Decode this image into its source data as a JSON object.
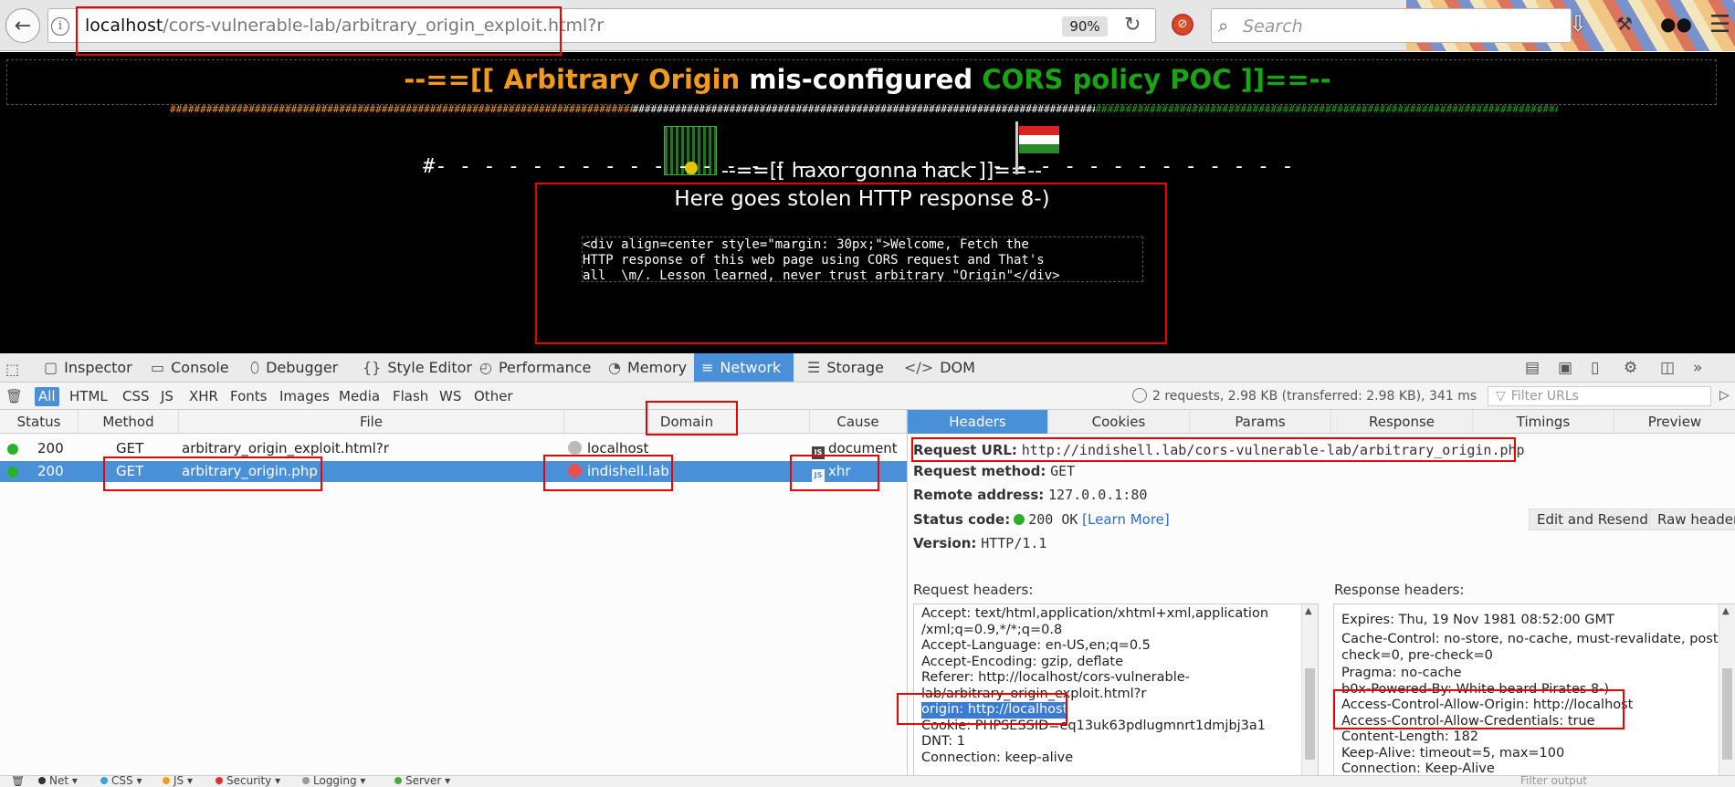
{
  "browser": {
    "url_host": "localhost",
    "url_path": "/cors-vulnerable-lab/arbitrary_origin_exploit.html?r",
    "zoom": "90%",
    "search_placeholder": "Search"
  },
  "page": {
    "title_part1": "--==[[ Arbitrary Origin ",
    "title_part2": "mis-configured ",
    "title_part3": "CORS policy POC ]]==--",
    "hash_segment_1": "##########################################################################################################",
    "hash_segment_2": "##########################################################################################################",
    "hash_segment_3": "##########################################################################################################",
    "subtitle": "--==[[ haxor gonna hack ]]==--",
    "dash_divider": "#- - - - - - - - - - - - - - - - - - - - - - - - - - - - - - - - - - - - - - - - - - - - - - - - - - - - - - - - - - - - - - - #",
    "stolen_title": "Here goes stolen HTTP response 8-)",
    "stolen_code": "<div align=center style=\"margin: 30px;\">Welcome, Fetch the\nHTTP response of this web page using CORS request and That's\nall  \\m/. Lesson learned, never trust arbitrary \"Origin\"</div>"
  },
  "devtools": {
    "tabs": [
      "Inspector",
      "Console",
      "Debugger",
      "Style Editor",
      "Performance",
      "Memory",
      "Network",
      "Storage",
      "DOM"
    ],
    "active_tab": "Network",
    "filter_types": [
      "All",
      "HTML",
      "CSS",
      "JS",
      "XHR",
      "Fonts",
      "Images",
      "Media",
      "Flash",
      "WS",
      "Other"
    ],
    "summary": "2 requests, 2.98 KB (transferred: 2.98 KB), 341 ms",
    "filter_placeholder": "Filter URLs",
    "columns": {
      "status": "Status",
      "method": "Method",
      "file": "File",
      "domain": "Domain",
      "cause": "Cause"
    },
    "requests": [
      {
        "status": "200",
        "method": "GET",
        "file": "arbitrary_origin_exploit.html?r",
        "domain": "localhost",
        "cause": "document"
      },
      {
        "status": "200",
        "method": "GET",
        "file": "arbitrary_origin.php",
        "domain": "indishell.lab",
        "cause": "xhr"
      }
    ],
    "detail_tabs": [
      "Headers",
      "Cookies",
      "Params",
      "Response",
      "Timings",
      "Preview"
    ],
    "request_url_label": "Request URL:",
    "request_url": "http://indishell.lab/cors-vulnerable-lab/arbitrary_origin.php",
    "request_method_label": "Request method:",
    "request_method": "GET",
    "remote_address_label": "Remote address:",
    "remote_address": "127.0.0.1:80",
    "status_code_label": "Status code:",
    "status_code": "200 OK",
    "learn_more": "[Learn More]",
    "version_label": "Version:",
    "version": "HTTP/1.1",
    "edit_resend": "Edit and Resend",
    "raw_headers": "Raw headers",
    "request_headers_label": "Request headers:",
    "response_headers_label": "Response headers:",
    "request_headers": [
      "Accept: text/html,application/xhtml+xml,application",
      "/xml;q=0.9,*/*;q=0.8",
      "Accept-Language: en-US,en;q=0.5",
      "Accept-Encoding: gzip, deflate",
      "Referer: http://localhost/cors-vulnerable-",
      "lab/arbitrary_origin_exploit.html?r",
      "origin: http://localhost",
      "Cookie: PHPSESSID=eq13uk63pdlugmnrt1dmjbj3a1",
      "DNT: 1",
      "Connection: keep-alive"
    ],
    "response_headers": [
      "Expires: Thu, 19 Nov 1981 08:52:00 GMT",
      "Cache-Control: no-store, no-cache, must-revalidate, post-",
      "check=0, pre-check=0",
      "Pragma: no-cache",
      "b0x-Powered-By: White beard Pirates 8-)",
      "Access-Control-Allow-Origin: http://localhost",
      "Access-Control-Allow-Credentials: true",
      "Content-Length: 182",
      "Keep-Alive: timeout=5, max=100",
      "Connection: Keep-Alive"
    ],
    "console_filters": [
      "Net",
      "CSS",
      "JS",
      "Security",
      "Logging",
      "Server"
    ],
    "console_filter_placeholder": "Filter output"
  },
  "colors": {
    "accent": "#4a90d9",
    "title_orange": "#f29a1c",
    "title_green": "#1aa313",
    "highlight_red": "#e00000",
    "status_green": "#2ab02a"
  }
}
